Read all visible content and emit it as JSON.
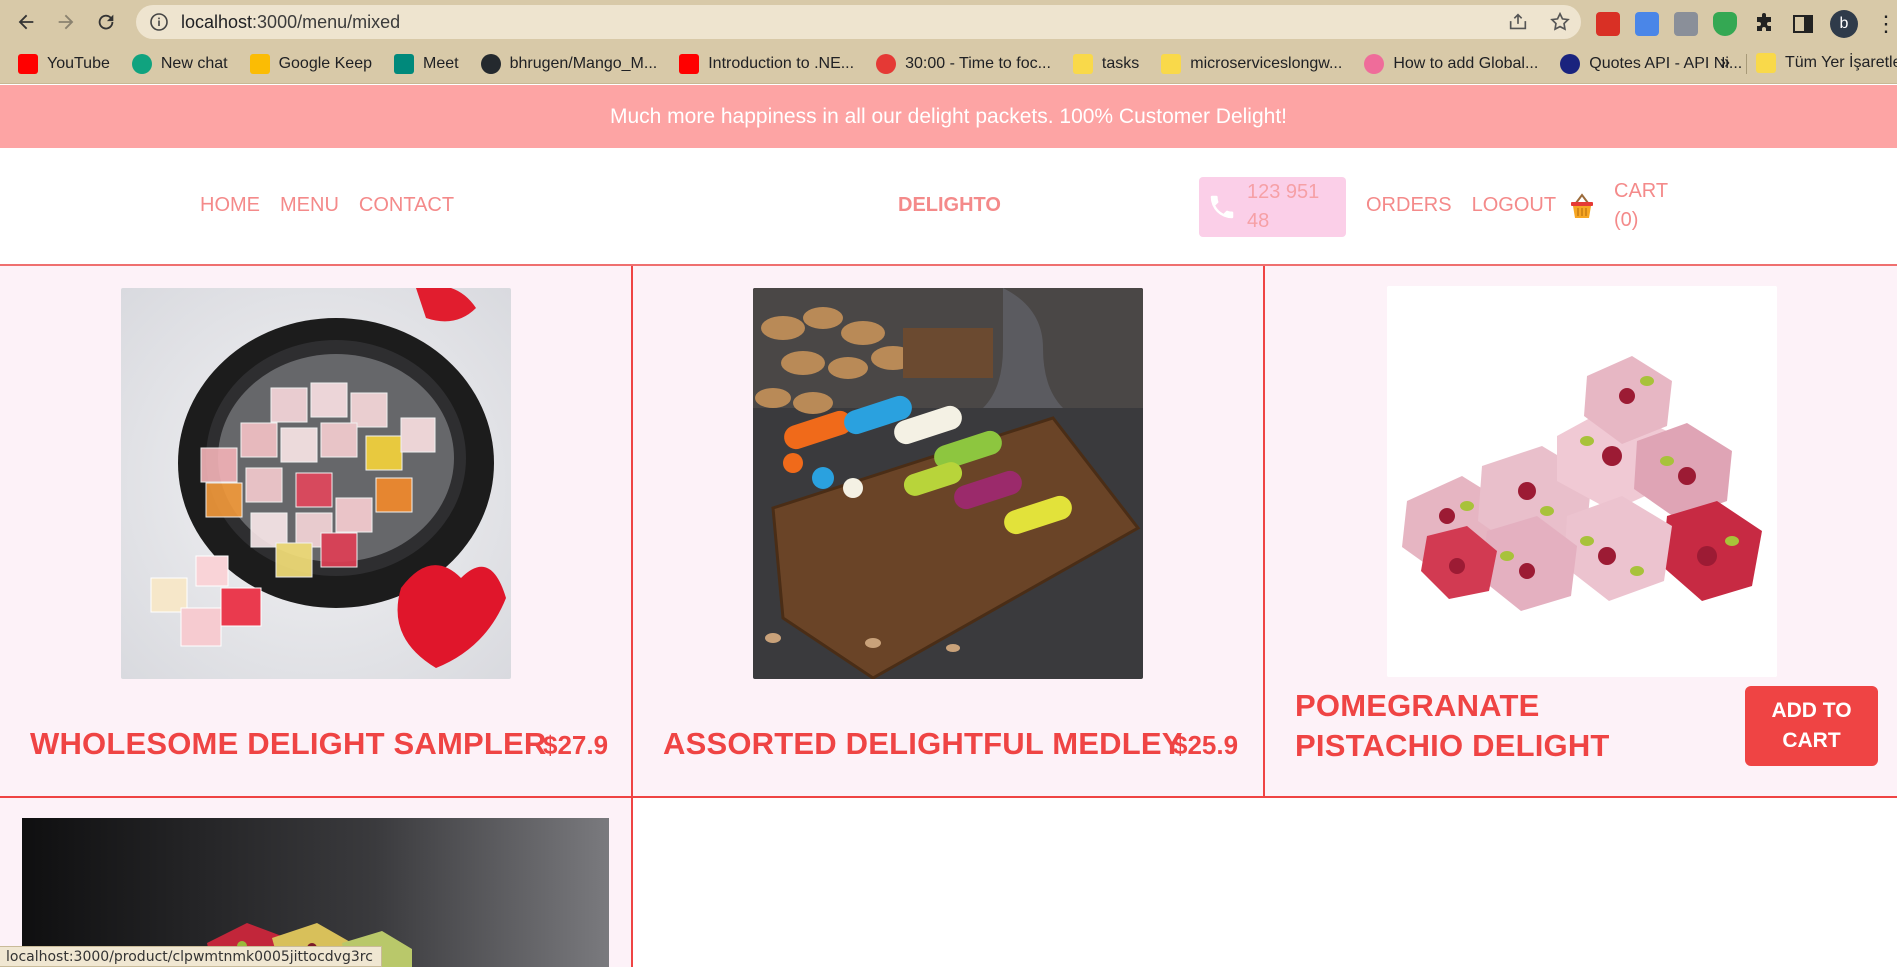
{
  "browser": {
    "url_host": "localhost",
    "url_path": ":3000/menu/mixed",
    "bookmarks": [
      {
        "label": "YouTube",
        "color": "#ff0000"
      },
      {
        "label": "New chat",
        "color": "#10a37f"
      },
      {
        "label": "Google Keep",
        "color": "#fbbc04"
      },
      {
        "label": "Meet",
        "color": "#00897b"
      },
      {
        "label": "bhrugen/Mango_M...",
        "color": "#24292e"
      },
      {
        "label": "Introduction to .NE...",
        "color": "#ff0000"
      },
      {
        "label": "30:00 - Time to foc...",
        "color": "#e53935"
      },
      {
        "label": "tasks",
        "color": "#f9d94a"
      },
      {
        "label": "microserviceslongw...",
        "color": "#f9d94a"
      },
      {
        "label": "How to add Global...",
        "color": "#ef6c9a"
      },
      {
        "label": "Quotes API - API Ni...",
        "color": "#1a237e"
      }
    ],
    "bookmarks_overflow": "»",
    "all_bookmarks": "Tüm Yer İşaretleri",
    "avatar_letter": "b",
    "status_url": "localhost:3000/product/clpwmtnmk0005jittocdvg3rc"
  },
  "banner": {
    "text": "Much more happiness in all our delight packets. 100% Customer Delight!"
  },
  "header": {
    "nav_left": [
      "HOME",
      "MENU",
      "CONTACT"
    ],
    "logo": "DELIGHTO",
    "phone": "123 951 48",
    "nav_right": [
      "ORDERS",
      "LOGOUT"
    ],
    "cart": "CART (0)"
  },
  "products": [
    {
      "title": "WHOLESOME DELIGHT SAMPLER",
      "price": "$27.9"
    },
    {
      "title": "ASSORTED DELIGHTFUL MEDLEY",
      "price": "$25.9"
    },
    {
      "title": "POMEGRANATE PISTACHIO DELIGHT",
      "button": "ADD TO CART"
    }
  ],
  "colors": {
    "accent": "#ef4444",
    "banner": "#fda4a4",
    "card_bg": "#fdf2f8",
    "nav_text": "#f48a8a",
    "phone_bg": "#fbcfe8"
  }
}
